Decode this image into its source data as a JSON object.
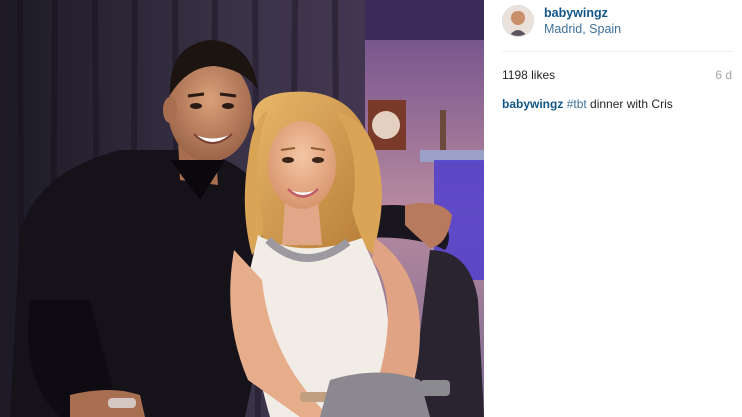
{
  "post": {
    "username": "babywingz",
    "location": "Madrid, Spain",
    "likes": "1198 likes",
    "age": "6 d",
    "caption": {
      "username": "babywingz",
      "hashtag": "#tbt",
      "text": " dinner with Cris"
    }
  }
}
